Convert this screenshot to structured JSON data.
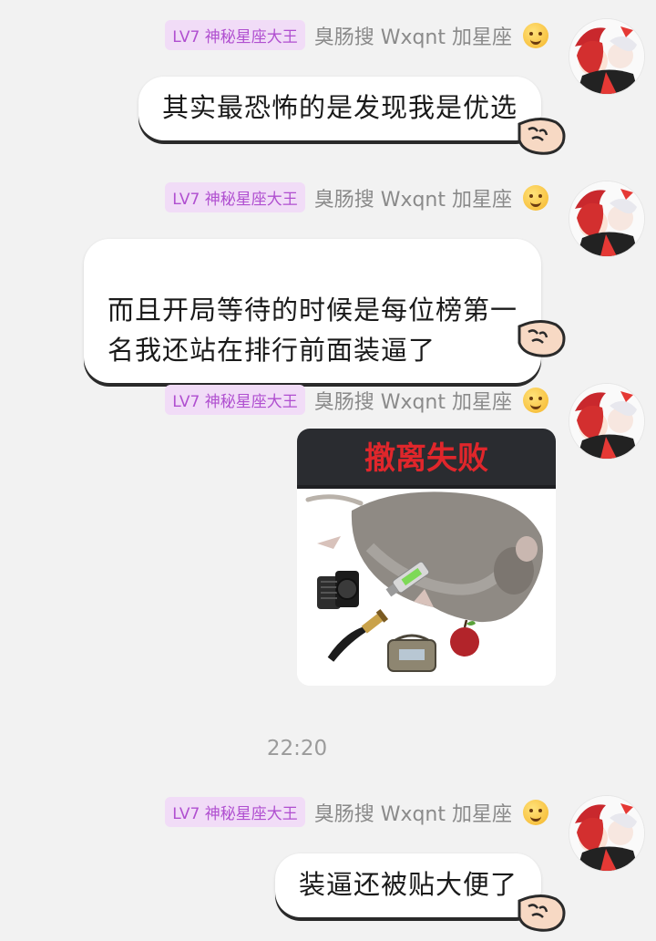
{
  "sender": {
    "badge": "LV7 神秘星座大王",
    "nickname": "臭肠搜 Wxqnt 加星座"
  },
  "messages": [
    {
      "text": "其实最恐怖的是发现我是优选"
    },
    {
      "text": "而且开局等待的时候是每位榜第一\n名我还站在排行前面装逼了"
    },
    {
      "image_text": "撤离失败"
    },
    {
      "text": "装逼还被贴大便了"
    }
  ],
  "timestamp": "22:20",
  "icons": {
    "emoji": "smiling-face-emoji-icon",
    "bubble_decoration": "hand-bubble-icon"
  },
  "colors": {
    "background": "#f2f2f2",
    "badge_bg": "#f1dcf7",
    "badge_text": "#b04fd0",
    "nickname": "#8a8a8a",
    "banner_text": "#e0262b",
    "banner_bg": "#2a2c30"
  }
}
